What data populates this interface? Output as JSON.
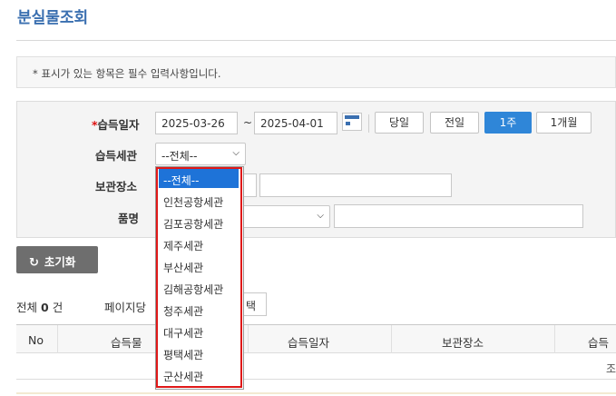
{
  "page": {
    "title": "분실물조회"
  },
  "notice": {
    "text": "* 표시가 있는 항목은 필수 입력사항입니다."
  },
  "search": {
    "date_label": "습득일자",
    "required_mark": "*",
    "date_from": "2025-03-26",
    "tilde": "~",
    "date_to": "2025-04-01",
    "quick_buttons": [
      "당일",
      "전일",
      "1주",
      "1개월"
    ],
    "active_quick": "1주",
    "customs_label": "습득세관",
    "customs_selected": "--전체--",
    "storage_label": "보관장소",
    "item_label": "품명"
  },
  "dropdown": {
    "options": [
      "--전체--",
      "인천공항세관",
      "김포공항세관",
      "제주세관",
      "부산세관",
      "김해공항세관",
      "청주세관",
      "대구세관",
      "평택세관",
      "군산세관"
    ],
    "selected_index": 0
  },
  "actions": {
    "reset_label": "초기화"
  },
  "results": {
    "total_prefix": "전체",
    "total_count": "0",
    "total_suffix": "건",
    "per_page_label": "페이지당",
    "per_page_btn_fragment": "택"
  },
  "table": {
    "headers": [
      "No",
      "습득물",
      "습득일자",
      "보관장소",
      "습득"
    ],
    "empty_fragment": "조"
  },
  "colors": {
    "accent": "#3a6fb0",
    "active_button": "#2f86d8",
    "selected_option": "#1e73d8",
    "highlight_border": "#e01818"
  }
}
